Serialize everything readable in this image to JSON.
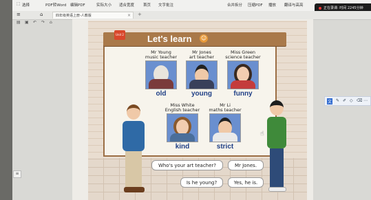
{
  "toolbar": {
    "items": [
      "选择",
      "PDF转Word",
      "编辑PDF",
      "实际大小",
      "适合宽度",
      "首页",
      "文字批注",
      "合并拆分",
      "压缩PDF",
      "播放",
      "翻译与高亮"
    ],
    "recording_text": "正在录课: 时间 2245分钟"
  },
  "tab": {
    "label": "四年级英语上册-人教版"
  },
  "lesson": {
    "title": "Let's learn",
    "badge": "Unit 2",
    "teachers": [
      {
        "name": "Mr Young",
        "subject": "music teacher",
        "word": "old"
      },
      {
        "name": "Mr Jones",
        "subject": "art teacher",
        "word": "young"
      },
      {
        "name": "Miss Green",
        "subject": "science teacher",
        "word": "funny"
      },
      {
        "name": "Miss White",
        "subject": "English teacher",
        "word": "kind"
      },
      {
        "name": "Mr Li",
        "subject": "maths teacher",
        "word": "strict"
      }
    ],
    "dialogue": {
      "q1": "Who's your art teacher?",
      "a1": "Mr Jones.",
      "q2": "Is he young?",
      "a2": "Yes, he is."
    }
  },
  "colors": {
    "word": "#1f3f86",
    "banner": "#a9794a",
    "record_bar": "#1c1c1c"
  },
  "icons": [
    "select-icon",
    "menu-icon",
    "back-icon",
    "forward-icon",
    "home-icon",
    "close-icon",
    "add-tab-icon"
  ]
}
